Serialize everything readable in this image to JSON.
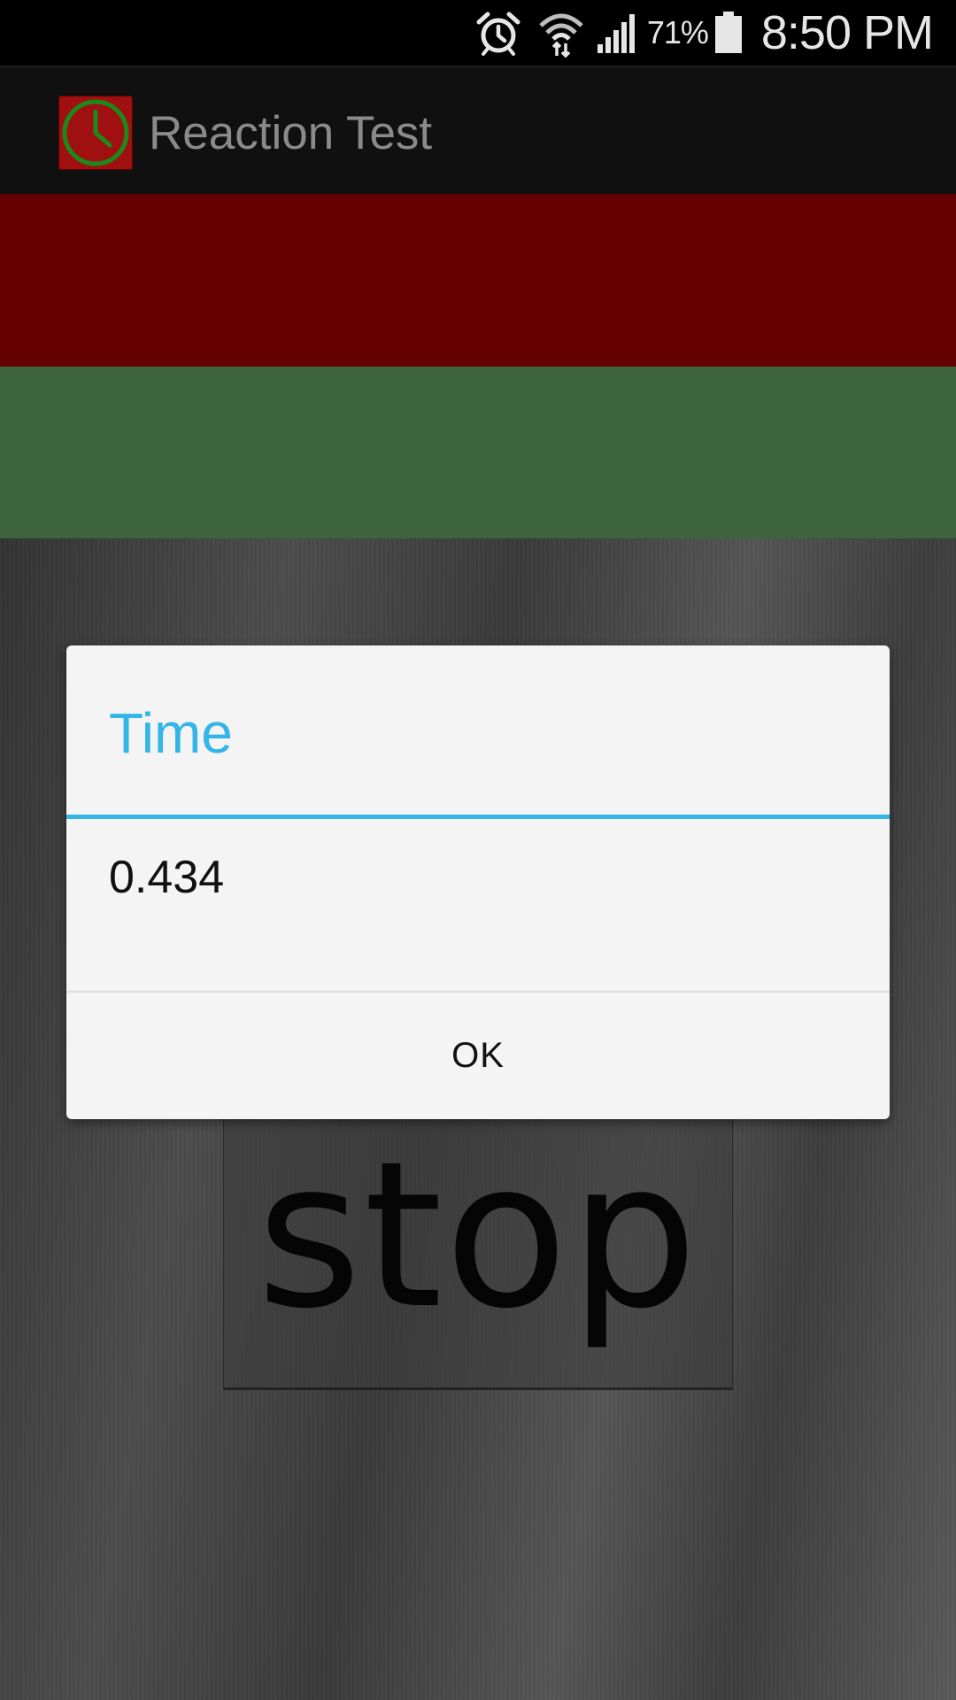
{
  "status_bar": {
    "battery_percent": "71%",
    "time": "8:50 PM",
    "icons": [
      "alarm-icon",
      "wifi-icon",
      "cell-signal-icon",
      "battery-icon"
    ]
  },
  "app": {
    "title": "Reaction Test",
    "icon": "clock-icon"
  },
  "bands": {
    "top_color": "#640000",
    "bottom_color": "#3e643e"
  },
  "main": {
    "stop_label": "stop"
  },
  "dialog": {
    "title": "Time",
    "message": "0.434",
    "ok_label": "OK",
    "accent_color": "#33b5e5"
  }
}
